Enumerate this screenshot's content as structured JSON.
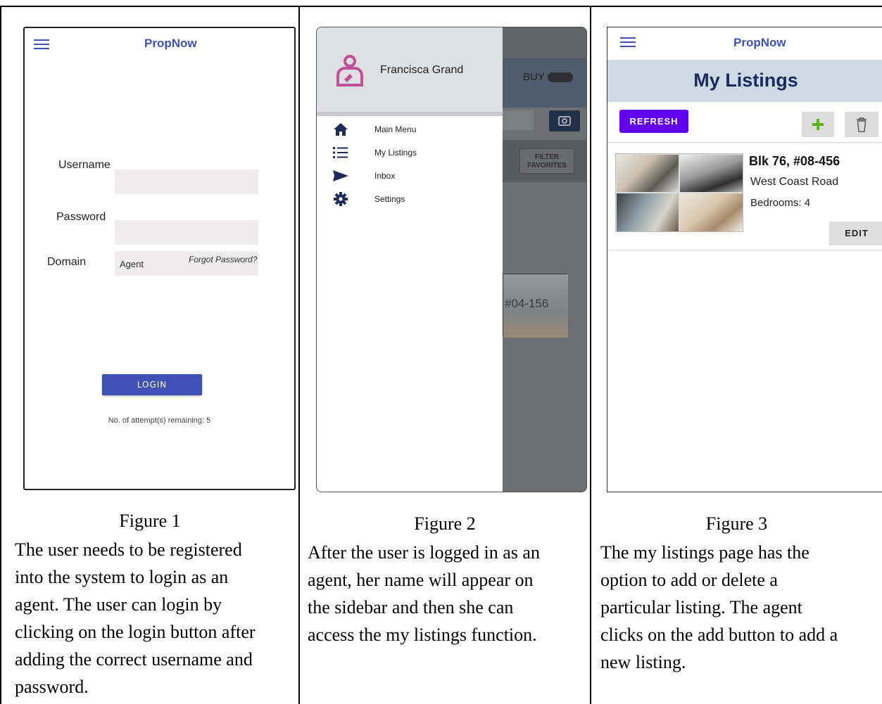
{
  "figure1": {
    "app_title": "PropNow",
    "username_label": "Username",
    "password_label": "Password",
    "domain_label": "Domain",
    "domain_value": "Agent",
    "forgot_password": "Forgot Password?",
    "login_label": "LOGIN",
    "attempts_text": "No. of attempt(s) remaining:  5",
    "caption_title": "Figure 1",
    "caption_lines": [
      "The user needs to be registered",
      "into the system to login as an",
      "agent. The user can login by",
      "clicking on the login button after",
      "adding the correct username and",
      "password."
    ]
  },
  "figure2": {
    "user_name": "Francisca Grand",
    "bg_buy": "BUY",
    "bg_filter": "FILTER\nFAVORITES",
    "bg_listing": "#04-156",
    "menu": [
      {
        "label": "Main Menu",
        "icon": "home-icon"
      },
      {
        "label": "My Listings",
        "icon": "list-icon"
      },
      {
        "label": "Inbox",
        "icon": "send-icon"
      },
      {
        "label": "Settings",
        "icon": "gear-icon"
      }
    ],
    "caption_title": "Figure 2",
    "caption_lines": [
      "After the user is logged in as an",
      "agent, her name will appear on",
      "the sidebar and then she can",
      "access the my listings function."
    ]
  },
  "figure3": {
    "app_title": "PropNow",
    "page_title": "My Listings",
    "refresh_label": "REFRESH",
    "listing": {
      "address": "Blk 76, #08-456",
      "street": "West Coast Road",
      "bedrooms": "Bedrooms: 4"
    },
    "edit_label": "EDIT",
    "caption_title": "Figure 3",
    "caption_lines": [
      "The my listings page has the",
      "option to add or delete a",
      "particular listing. The agent",
      "clicks on the add button to add a",
      "new listing."
    ]
  },
  "colors": {
    "brand": "#3f51b5",
    "refresh": "#6200ee",
    "add": "#5bb318",
    "profile": "#c0509a"
  }
}
